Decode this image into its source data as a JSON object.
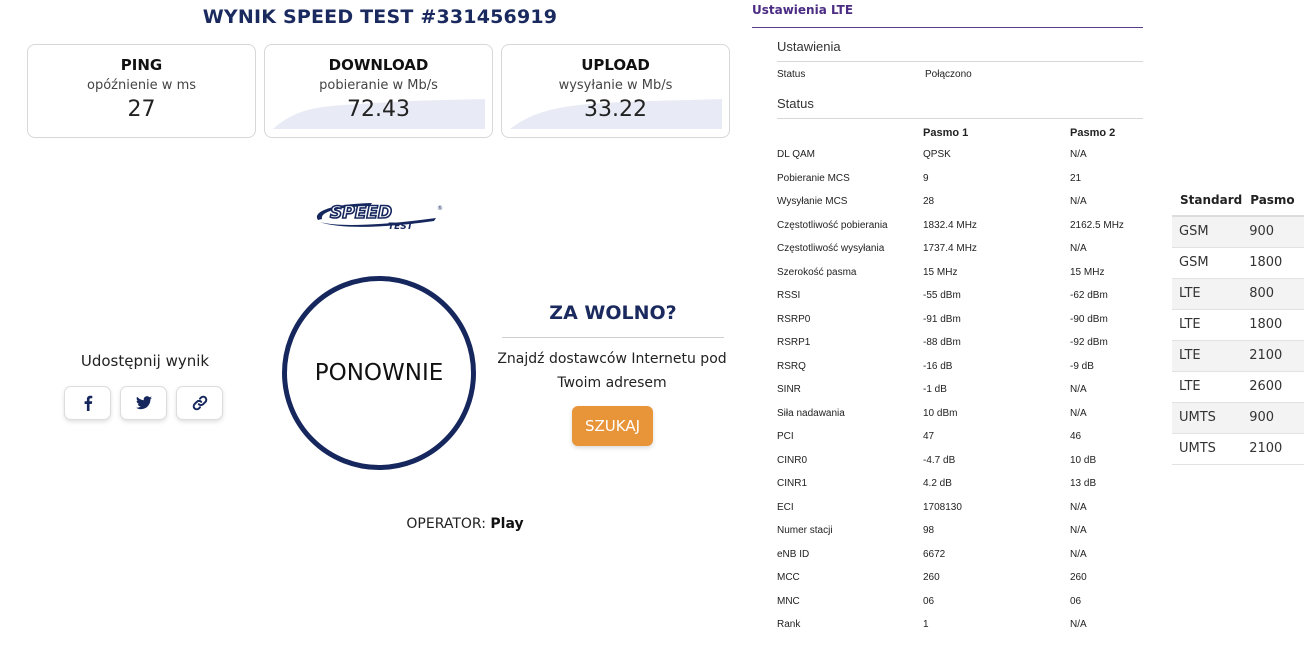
{
  "speedtest": {
    "title": "WYNIK SPEED TEST #331456919",
    "ping": {
      "title": "PING",
      "subtitle": "opóźnienie w ms",
      "value": "27"
    },
    "download": {
      "title": "DOWNLOAD",
      "subtitle": "pobieranie w Mb/s",
      "value": "72.43"
    },
    "upload": {
      "title": "UPLOAD",
      "subtitle": "wysyłanie w Mb/s",
      "value": "33.22"
    },
    "logo_text": "SPEED",
    "logo_subtext": "TEST",
    "logo_mark": "®",
    "share_label": "Udostępnij wynik",
    "again_label": "PONOWNIE",
    "too_slow": {
      "title": "ZA WOLNO?",
      "text": "Znajdź dostawców Internetu pod Twoim adresem",
      "button": "SZUKAJ"
    },
    "operator_label": "OPERATOR:",
    "operator_value": "Play",
    "colors": {
      "navy": "#1b2a5e",
      "orange": "#e8953a"
    }
  },
  "lte": {
    "header": "Ustawienia LTE",
    "settings_section": "Ustawienia",
    "status_label": "Status",
    "status_value": "Połączono",
    "status_section": "Status",
    "columns": [
      "",
      "Pasmo 1",
      "Pasmo 2"
    ],
    "rows": [
      [
        "DL QAM",
        "QPSK",
        "N/A"
      ],
      [
        "Pobieranie MCS",
        "9",
        "21"
      ],
      [
        "Wysyłanie MCS",
        "28",
        "N/A"
      ],
      [
        "Częstotliwość pobierania",
        "1832.4 MHz",
        "2162.5 MHz"
      ],
      [
        "Częstotliwość wysyłania",
        "1737.4 MHz",
        "N/A"
      ],
      [
        "Szerokość pasma",
        "15 MHz",
        "15 MHz"
      ],
      [
        "RSSI",
        "-55 dBm",
        "-62 dBm"
      ],
      [
        "RSRP0",
        "-91 dBm",
        "-90 dBm"
      ],
      [
        "RSRP1",
        "-88 dBm",
        "-92 dBm"
      ],
      [
        "RSRQ",
        "-16 dB",
        "-9 dB"
      ],
      [
        "SINR",
        "-1 dB",
        "N/A"
      ],
      [
        "Siła nadawania",
        "10 dBm",
        "N/A"
      ],
      [
        "PCI",
        "47",
        "46"
      ],
      [
        "CINR0",
        "-4.7 dB",
        "10 dB"
      ],
      [
        "CINR1",
        "4.2 dB",
        "13 dB"
      ],
      [
        "ECI",
        "1708130",
        "N/A"
      ],
      [
        "Numer stacji",
        "98",
        "N/A"
      ],
      [
        "eNB ID",
        "6672",
        "N/A"
      ],
      [
        "MCC",
        "260",
        "260"
      ],
      [
        "MNC",
        "06",
        "06"
      ],
      [
        "Rank",
        "1",
        "N/A"
      ]
    ]
  },
  "standards": {
    "columns": [
      "Standard",
      "Pasmo"
    ],
    "rows": [
      [
        "GSM",
        "900"
      ],
      [
        "GSM",
        "1800"
      ],
      [
        "LTE",
        "800"
      ],
      [
        "LTE",
        "1800"
      ],
      [
        "LTE",
        "2100"
      ],
      [
        "LTE",
        "2600"
      ],
      [
        "UMTS",
        "900"
      ],
      [
        "UMTS",
        "2100"
      ]
    ]
  }
}
